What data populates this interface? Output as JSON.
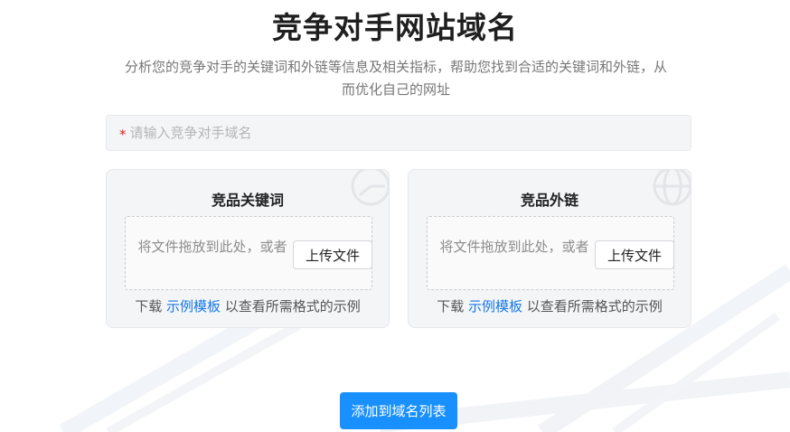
{
  "header": {
    "title": "竞争对手网站域名",
    "subtitle_line1": "分析您的竞争对手的关键词和外链等信息及相关指标，帮助您找到合适的关键词和外链，从",
    "subtitle_line2": "而优化自己的网址"
  },
  "domain_input": {
    "required_mark": "*",
    "placeholder": "请输入竞争对手域名",
    "value": ""
  },
  "cards": [
    {
      "title": "竞品关键词",
      "drop_text": "将文件拖放到此处，或者",
      "upload_label": "上传文件",
      "template_prefix": "下载",
      "template_link": "示例模板",
      "template_suffix": "以查看所需格式的示例",
      "deco_icon": "chart-icon"
    },
    {
      "title": "竞品外链",
      "drop_text": "将文件拖放到此处，或者",
      "upload_label": "上传文件",
      "template_prefix": "下载",
      "template_link": "示例模板",
      "template_suffix": "以查看所需格式的示例",
      "deco_icon": "globe-icon"
    }
  ],
  "submit": {
    "label": "添加到域名列表"
  },
  "colors": {
    "accent": "#1890ff",
    "link": "#1677e8",
    "required": "#e02020",
    "card_bg": "#f4f5f7"
  }
}
